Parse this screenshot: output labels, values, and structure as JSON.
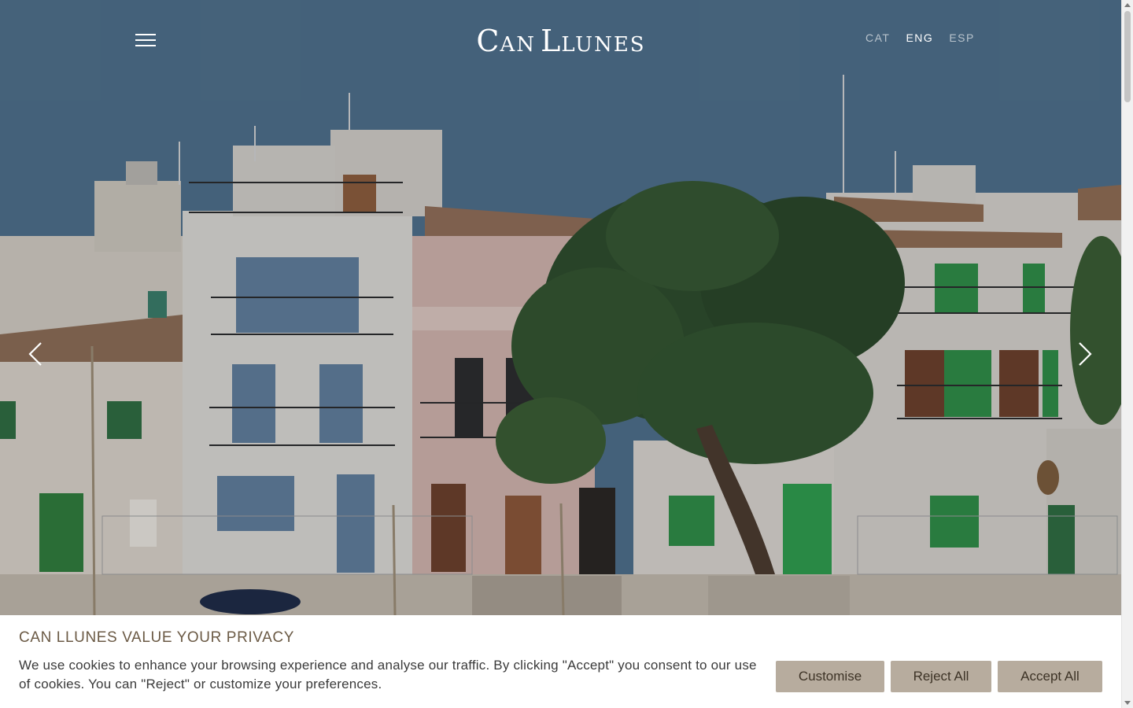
{
  "header": {
    "logo_big_1": "C",
    "logo_small_1": "AN",
    "logo_big_2": "L",
    "logo_small_2": "LUNES",
    "languages": [
      {
        "code": "CAT",
        "active": false
      },
      {
        "code": "ENG",
        "active": true
      },
      {
        "code": "ESP",
        "active": false
      }
    ]
  },
  "hero": {
    "icons": {
      "menu": "hamburger-icon",
      "prev": "chevron-left-icon",
      "next": "chevron-right-icon"
    }
  },
  "cookie_banner": {
    "title": "CAN LLUNES VALUE YOUR PRIVACY",
    "text": "We use cookies to enhance your browsing experience and analyse our traffic. By clicking \"Accept\" you consent to our use of cookies. You can \"Reject\" or customize your preferences.",
    "buttons": {
      "customise": "Customise",
      "reject": "Reject All",
      "accept": "Accept All"
    }
  },
  "colors": {
    "sky": "#4d6d87",
    "button_bg": "#b7ac9e",
    "title": "#6b5a45"
  }
}
